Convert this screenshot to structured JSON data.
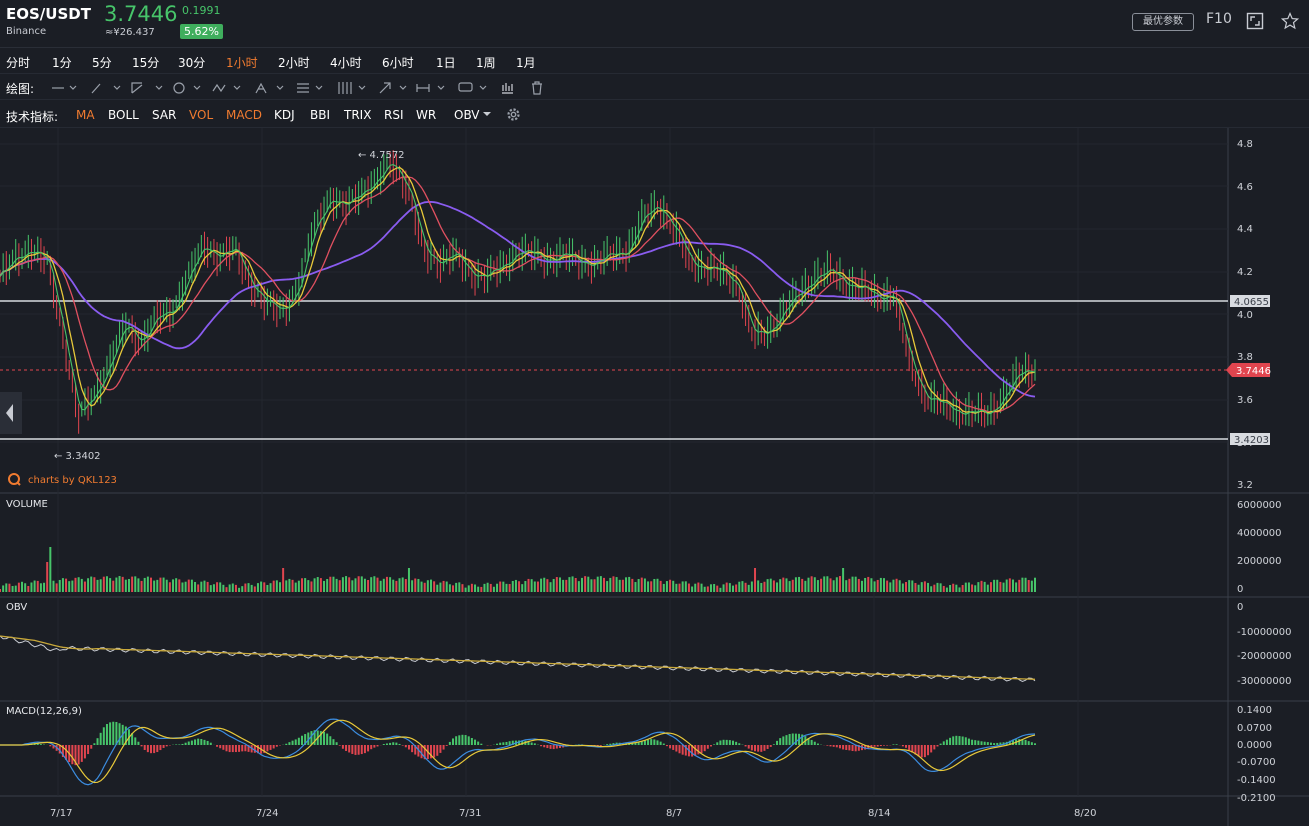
{
  "header": {
    "pair": "EOS/USDT",
    "exchange": "Binance",
    "price": "3.7446",
    "cny": "≈¥26.437",
    "change": "0.1991",
    "change_pct": "5.62%",
    "params_label": "最优参数",
    "f10_label": "F10",
    "icons": [
      "fullscreen-icon",
      "star-icon"
    ]
  },
  "intervals": {
    "items": [
      "分时",
      "1分",
      "5分",
      "15分",
      "30分",
      "1小时",
      "2小时",
      "4小时",
      "6小时",
      "1日",
      "1周",
      "1月"
    ],
    "active": "1小时"
  },
  "drawing": {
    "label": "绘图:",
    "tools": [
      "horizontal-line-tool-icon",
      "pen-tool-icon",
      "trendline-tool-icon",
      "circle-tool-icon",
      "zigzag-tool-icon",
      "pattern-tool-icon",
      "fibonacci-tool-icon",
      "channel-tool-icon",
      "arrow-tool-icon",
      "measure-tool-icon",
      "comment-tool-icon",
      "bar-style-icon",
      "trash-icon"
    ]
  },
  "indicators": {
    "label": "技术指标:",
    "items": [
      "MA",
      "BOLL",
      "SAR",
      "VOL",
      "MACD",
      "KDJ",
      "BBI",
      "TRIX",
      "RSI",
      "WR",
      "OBV"
    ],
    "active": [
      "MA",
      "VOL",
      "MACD"
    ],
    "settings_icon": "gear-icon"
  },
  "colors": {
    "up": "#47c56a",
    "down": "#e0454f",
    "accent": "#f07b30",
    "ma_purple": "#8a5cf0",
    "ma_red": "#e05060",
    "ma_yellow": "#e8c93a",
    "ma_green": "#47c56a",
    "last_price": "#e0454f"
  },
  "chart_data": [
    {
      "type": "line",
      "panel": "price",
      "x_ticks": [
        "7/17",
        "7/24",
        "7/31",
        "8/7",
        "8/14",
        "8/20"
      ],
      "y_ticks": [
        "4.8",
        "4.6",
        "4.4",
        "4.2",
        "4.0",
        "3.8",
        "3.6",
        "3.4",
        "3.2"
      ],
      "ylim": [
        3.2,
        4.8
      ],
      "high_label": "← 4.7572",
      "low_label": "← 3.3402",
      "hline_upper": "4.0655",
      "hline_lower": "3.4203",
      "last_price": "3.7446",
      "watermark": "charts by QKL123",
      "close": [
        4.18,
        4.26,
        4.31,
        4.25,
        3.92,
        3.52,
        3.62,
        3.78,
        3.95,
        3.88,
        3.98,
        4.02,
        4.18,
        4.32,
        4.28,
        4.3,
        4.15,
        4.05,
        4.02,
        4.12,
        4.4,
        4.55,
        4.5,
        4.58,
        4.62,
        4.72,
        4.6,
        4.3,
        4.25,
        4.28,
        4.2,
        4.18,
        4.22,
        4.3,
        4.28,
        4.26,
        4.28,
        4.25,
        4.24,
        4.28,
        4.3,
        4.45,
        4.52,
        4.4,
        4.25,
        4.22,
        4.2,
        4.15,
        3.9,
        3.92,
        4.02,
        4.1,
        4.18,
        4.2,
        4.15,
        4.12,
        4.08,
        4.1,
        3.78,
        3.62,
        3.58,
        3.55,
        3.54,
        3.53,
        3.62,
        3.72,
        3.75
      ]
    },
    {
      "type": "bar",
      "panel": "volume",
      "title": "VOLUME",
      "y_ticks": [
        "6000000",
        "4000000",
        "2000000",
        "0"
      ]
    },
    {
      "type": "line",
      "panel": "obv",
      "title": "OBV",
      "y_ticks": [
        "0",
        "-10000000",
        "-20000000",
        "-30000000"
      ]
    },
    {
      "type": "line",
      "panel": "macd",
      "title": "MACD(12,26,9)",
      "y_ticks": [
        "0.1400",
        "0.0700",
        "0.0000",
        "-0.0700",
        "-0.1400",
        "-0.2100"
      ]
    }
  ]
}
